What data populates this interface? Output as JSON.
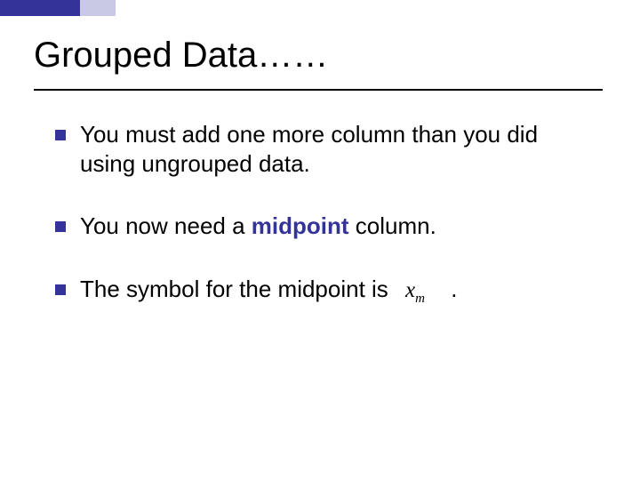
{
  "title": "Grouped Data……",
  "bullets": {
    "b1": "You must add one more column than you did using ungrouped data.",
    "b2_pre": "You now need a ",
    "b2_mid": "midpoint",
    "b2_post": " column.",
    "b3_pre": "The symbol for the midpoint is ",
    "b3_symbol_x": "x",
    "b3_symbol_sub": "m",
    "b3_period": "."
  },
  "colors": {
    "accent": "#333399",
    "accent_light": "#c9c9e6"
  }
}
